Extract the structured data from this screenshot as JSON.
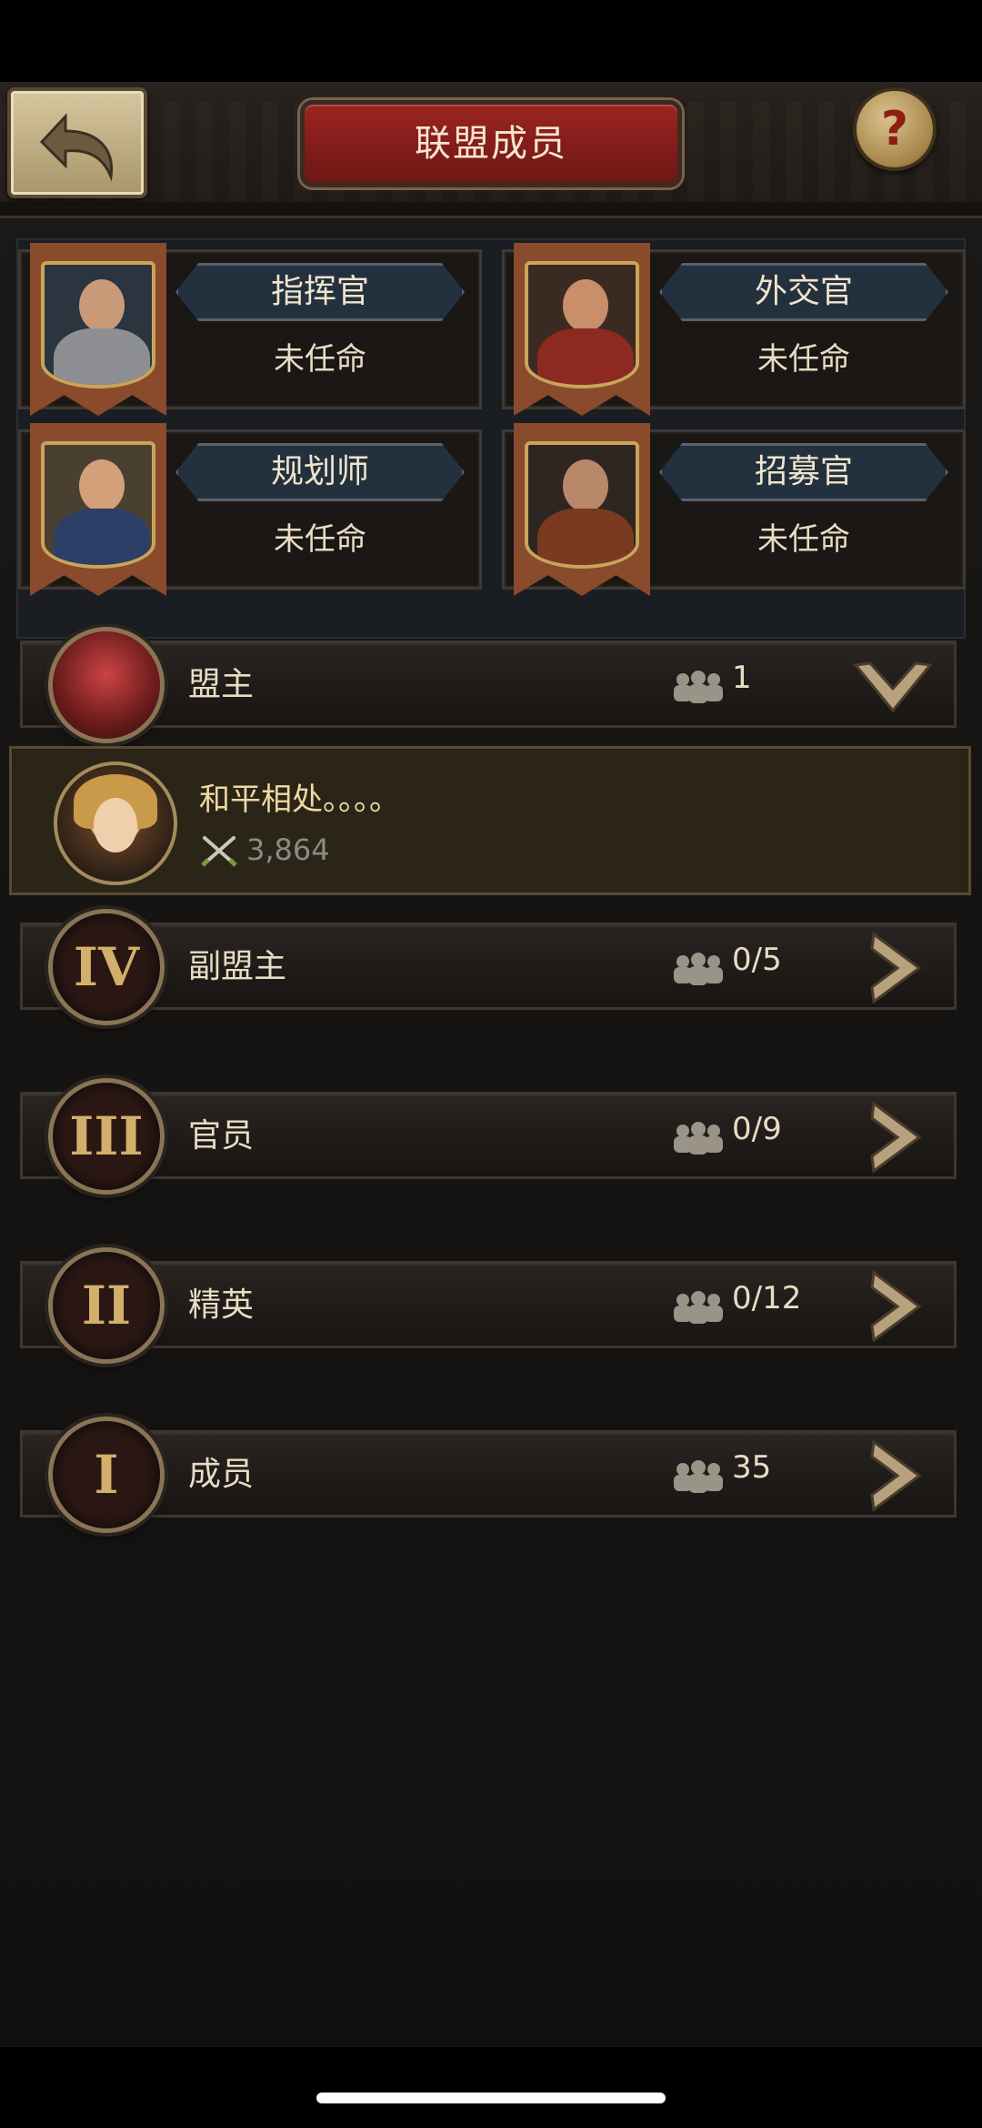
{
  "header": {
    "title": "联盟成员",
    "back_icon": "back-arrow-icon",
    "help_label": "?"
  },
  "officers": [
    {
      "role": "指挥官",
      "status": "未任命"
    },
    {
      "role": "外交官",
      "status": "未任命"
    },
    {
      "role": "规划师",
      "status": "未任命"
    },
    {
      "role": "招募官",
      "status": "未任命"
    }
  ],
  "ranks": [
    {
      "label": "盟主",
      "count": "1",
      "medal": "",
      "expanded": true
    },
    {
      "label": "副盟主",
      "count": "0/5",
      "medal": "IV",
      "expanded": false
    },
    {
      "label": "官员",
      "count": "0/9",
      "medal": "III",
      "expanded": false
    },
    {
      "label": "精英",
      "count": "0/12",
      "medal": "II",
      "expanded": false
    },
    {
      "label": "成员",
      "count": "35",
      "medal": "I",
      "expanded": false
    }
  ],
  "leader": {
    "name": "和平相处。。。。",
    "power": "3,864"
  },
  "colors": {
    "accent_red": "#9b2420",
    "gold": "#c9a55a",
    "text": "#e8dcc4"
  }
}
